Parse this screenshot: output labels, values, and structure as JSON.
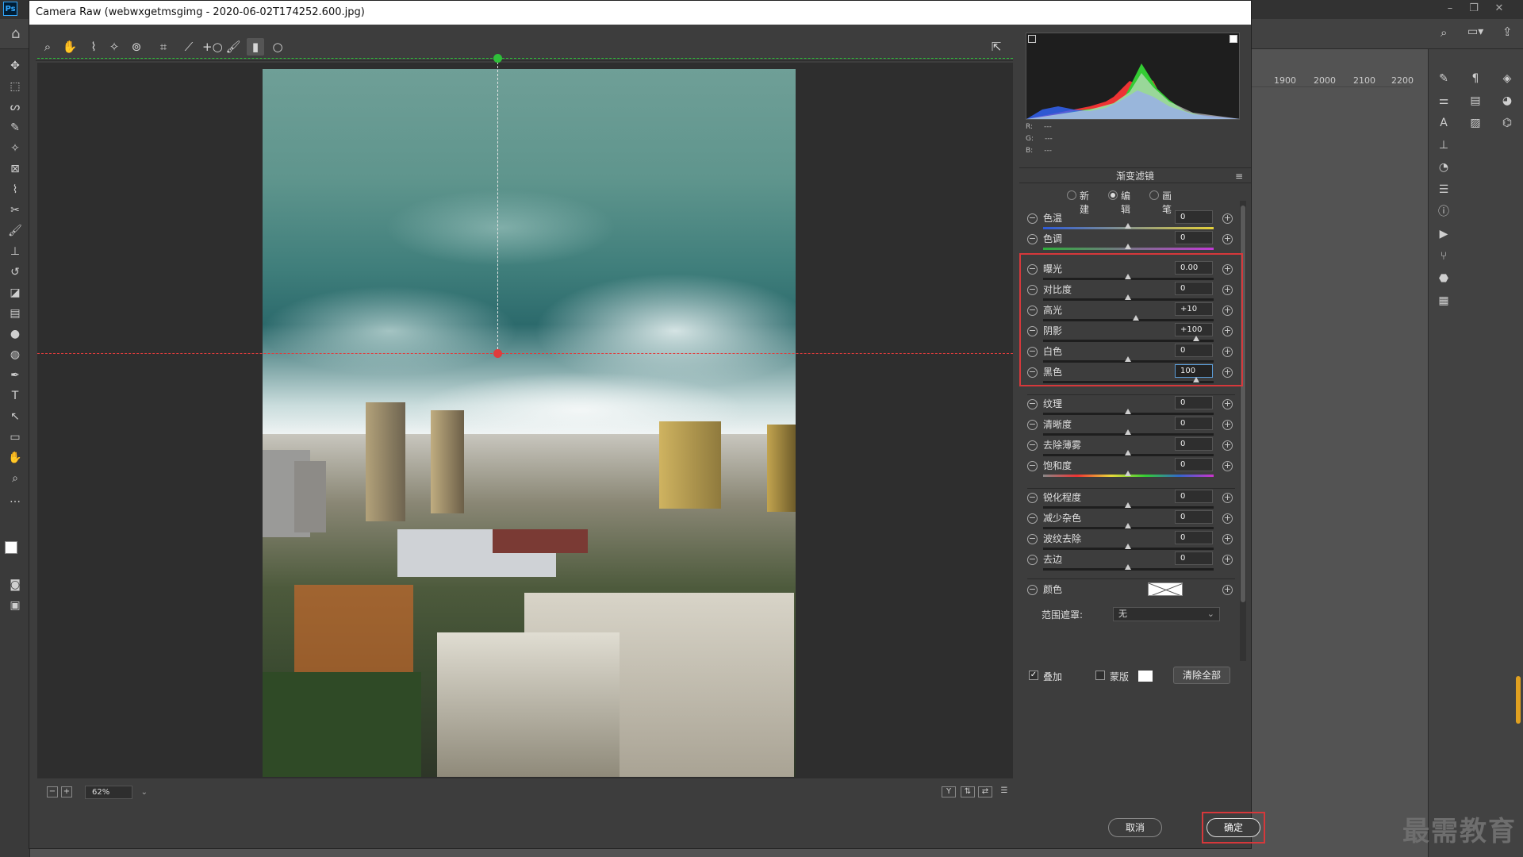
{
  "app": {
    "ps_logo": "Ps",
    "dialog_title": "Camera Raw (webwxgetmsgimg - 2020-06-02T174252.600.jpg)"
  },
  "ruler": {
    "ticks": [
      "1900",
      "2000",
      "2100",
      "2200"
    ]
  },
  "statusbar": {
    "zoom": "62%"
  },
  "histogram": {
    "r_label": "R:",
    "g_label": "G:",
    "b_label": "B:",
    "r_value": "---",
    "g_value": "---",
    "b_value": "---"
  },
  "panel": {
    "title": "渐变滤镜",
    "modes": [
      {
        "label": "新建",
        "selected": false
      },
      {
        "label": "编辑",
        "selected": true
      },
      {
        "label": "画笔",
        "selected": false
      }
    ],
    "sliders": [
      {
        "label": "色温",
        "value": "0"
      },
      {
        "label": "色调",
        "value": "0"
      },
      {
        "label": "曝光",
        "value": "0.00"
      },
      {
        "label": "对比度",
        "value": "0"
      },
      {
        "label": "高光",
        "value": "+10"
      },
      {
        "label": "阴影",
        "value": "+100"
      },
      {
        "label": "白色",
        "value": "0"
      },
      {
        "label": "黑色",
        "value": "100"
      },
      {
        "label": "纹理",
        "value": "0"
      },
      {
        "label": "清晰度",
        "value": "0"
      },
      {
        "label": "去除薄雾",
        "value": "0"
      },
      {
        "label": "饱和度",
        "value": "0"
      },
      {
        "label": "锐化程度",
        "value": "0"
      },
      {
        "label": "减少杂色",
        "value": "0"
      },
      {
        "label": "波纹去除",
        "value": "0"
      },
      {
        "label": "去边",
        "value": "0"
      }
    ],
    "color_label": "颜色",
    "range_mask_label": "范围遮罩:",
    "range_mask_value": "无",
    "overlay_label": "叠加",
    "overlay_checked": true,
    "mask_label": "蒙版",
    "mask_checked": false,
    "clear_all": "清除全部"
  },
  "buttons": {
    "cancel": "取消",
    "ok": "确定"
  },
  "watermark": "最需教育",
  "colors": {
    "highlight": "#d6383b",
    "green_guide": "#2fbf3a",
    "red_guide": "#e03c3c"
  }
}
